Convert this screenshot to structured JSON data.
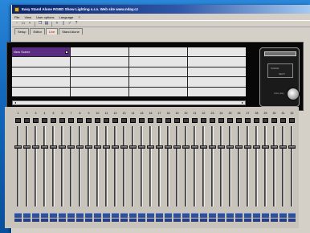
{
  "window": {
    "title": "Easy Stand Alone RGBD Show Lighting s.r.o. Web site www.nday.cz"
  },
  "menu": [
    "File",
    "View",
    "User options",
    "Language",
    "?"
  ],
  "toolbar": {
    "icons": [
      "new-icon",
      "open-icon",
      "save-icon",
      "copy-icon",
      "paste-icon",
      "add-icon",
      "delete-icon",
      "check-icon",
      "help-icon"
    ]
  },
  "tabs": [
    {
      "label": "Setup",
      "active": false
    },
    {
      "label": "Editor",
      "active": false
    },
    {
      "label": "Live",
      "active": true
    },
    {
      "label": "Stand Alone",
      "active": false
    }
  ],
  "scenes": {
    "columns": 4,
    "cells": [
      "New Scene",
      "",
      "",
      "",
      "",
      "",
      "",
      "",
      "",
      "",
      "",
      "",
      "",
      "",
      "",
      "",
      "",
      "",
      "",
      ""
    ],
    "selected_index": 0
  },
  "controller": {
    "screen_line1": "SCENE",
    "screen_line2": "NEXT",
    "knob_label": "Auto play"
  },
  "faders": {
    "channel_numbers": [
      "1",
      "2",
      "3",
      "4",
      "5",
      "6",
      "7",
      "8",
      "9",
      "10",
      "11",
      "12",
      "13",
      "14",
      "15",
      "16",
      "17",
      "18",
      "19",
      "20",
      "21",
      "22",
      "23",
      "24",
      "25",
      "26",
      "27",
      "28",
      "29",
      "30",
      "31",
      "32"
    ],
    "levels": [
      0.74,
      0.74,
      0.74,
      0.74,
      0.74,
      0.74,
      0.74,
      0.74,
      0.74,
      0.74,
      0.74,
      0.74,
      0.74,
      0.74,
      0.74,
      0.74,
      0.74,
      0.74,
      0.74,
      0.74,
      0.74,
      0.74,
      0.74,
      0.74,
      0.74,
      0.74,
      0.74,
      0.74,
      0.74,
      0.74,
      0.74,
      0.74
    ]
  },
  "colors": {
    "title_bar": "#0a246a",
    "active_tab": "#c00000",
    "selected_scene": "#5b2a82",
    "panel": "#070707",
    "desktop": "#0f6fc4"
  }
}
